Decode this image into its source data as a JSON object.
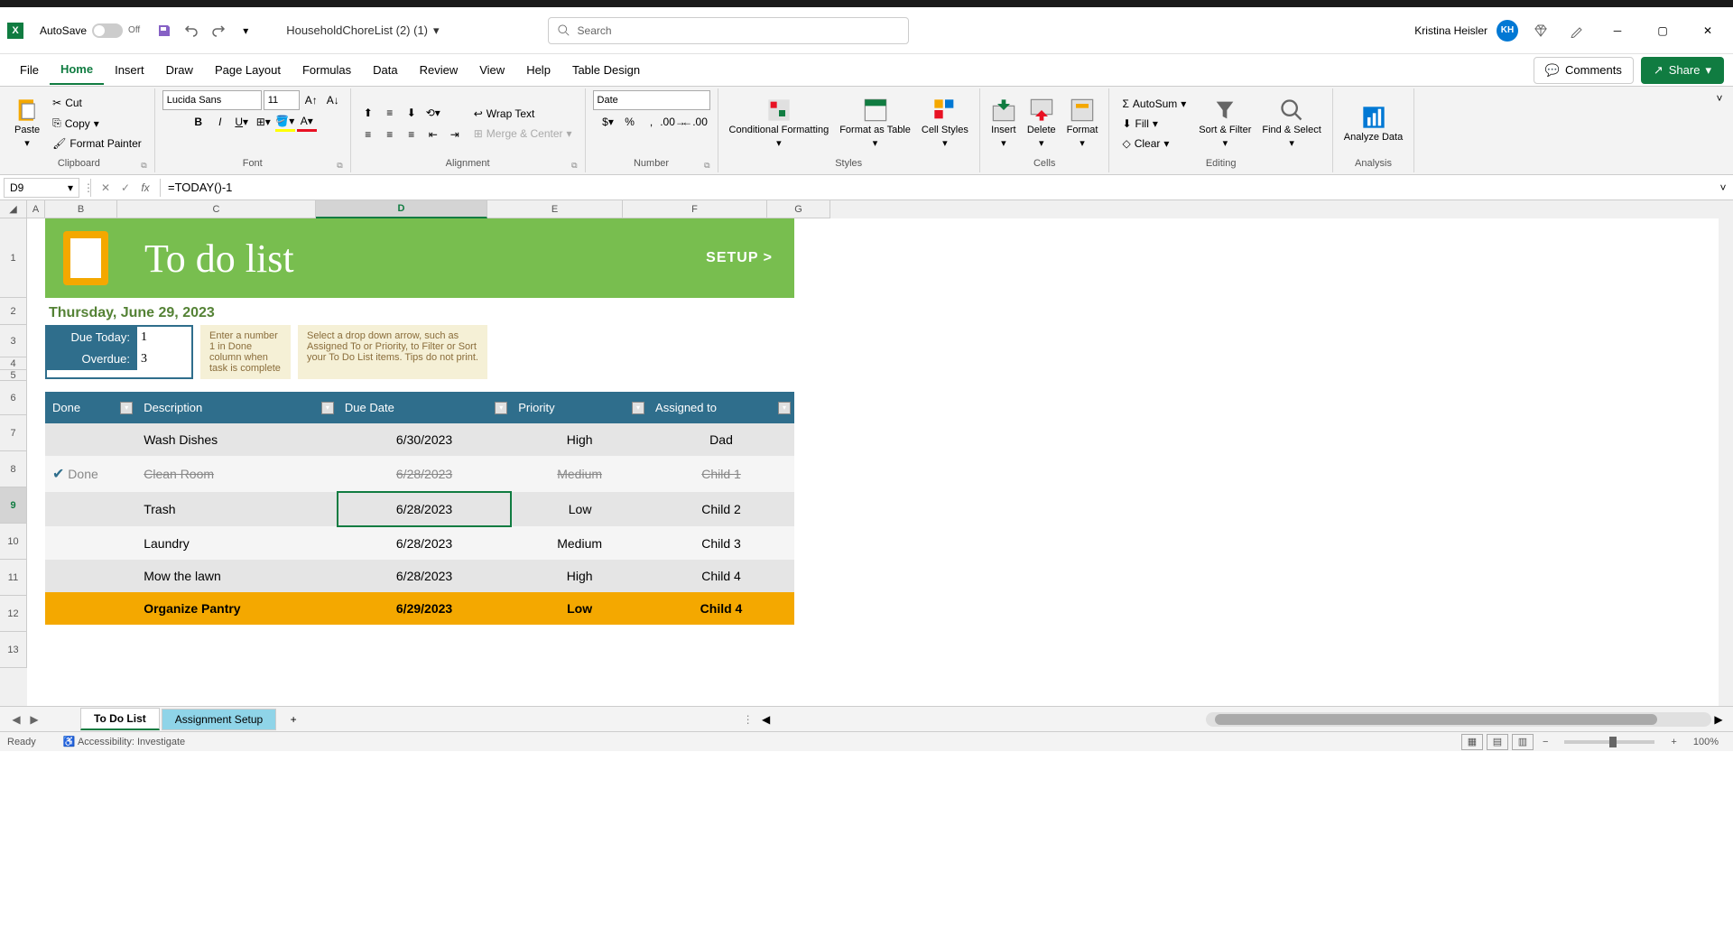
{
  "app": {
    "autosave_label": "AutoSave",
    "autosave_state": "Off",
    "filename": "HouseholdChoreList (2) (1)",
    "search_placeholder": "Search",
    "user_name": "Kristina Heisler",
    "user_initials": "KH"
  },
  "tabs": {
    "file": "File",
    "home": "Home",
    "insert": "Insert",
    "draw": "Draw",
    "page_layout": "Page Layout",
    "formulas": "Formulas",
    "data": "Data",
    "review": "Review",
    "view": "View",
    "help": "Help",
    "table_design": "Table Design",
    "comments": "Comments",
    "share": "Share"
  },
  "ribbon": {
    "clipboard": {
      "paste": "Paste",
      "cut": "Cut",
      "copy": "Copy",
      "format_painter": "Format Painter",
      "label": "Clipboard"
    },
    "font": {
      "name": "Lucida Sans",
      "size": "11",
      "label": "Font"
    },
    "alignment": {
      "wrap": "Wrap Text",
      "merge": "Merge & Center",
      "label": "Alignment"
    },
    "number": {
      "format": "Date",
      "label": "Number"
    },
    "styles": {
      "cond": "Conditional Formatting",
      "format_as": "Format as Table",
      "cell": "Cell Styles",
      "label": "Styles"
    },
    "cells": {
      "insert": "Insert",
      "delete": "Delete",
      "format": "Format",
      "label": "Cells"
    },
    "editing": {
      "autosum": "AutoSum",
      "fill": "Fill",
      "clear": "Clear",
      "sort": "Sort & Filter",
      "find": "Find & Select",
      "label": "Editing"
    },
    "analysis": {
      "analyze": "Analyze Data",
      "label": "Analysis"
    }
  },
  "formula_bar": {
    "cell_ref": "D9",
    "formula": "=TODAY()-1"
  },
  "columns": [
    "A",
    "B",
    "C",
    "D",
    "E",
    "F",
    "G"
  ],
  "rows": [
    "1",
    "2",
    "3",
    "4",
    "5",
    "6",
    "7",
    "8",
    "9",
    "10",
    "11",
    "12",
    "13"
  ],
  "todo": {
    "title": "To do list",
    "setup": "SETUP >",
    "date": "Thursday, June 29, 2023",
    "due_today_label": "Due Today:",
    "due_today_val": "1",
    "overdue_label": "Overdue:",
    "overdue_val": "3",
    "tip1": "Enter a number 1 in Done column when task is complete",
    "tip2": "Select a drop down arrow, such as Assigned To or Priority, to Filter or Sort your To Do List items. Tips do not print."
  },
  "table": {
    "headers": {
      "done": "Done",
      "desc": "Description",
      "due": "Due Date",
      "priority": "Priority",
      "assigned": "Assigned to"
    },
    "rows": [
      {
        "done": "",
        "desc": "Wash Dishes",
        "due": "6/30/2023",
        "priority": "High",
        "assigned": "Dad"
      },
      {
        "done": "Done",
        "desc": "Clean Room",
        "due": "6/28/2023",
        "priority": "Medium",
        "assigned": "Child 1"
      },
      {
        "done": "",
        "desc": "Trash",
        "due": "6/28/2023",
        "priority": "Low",
        "assigned": "Child 2"
      },
      {
        "done": "",
        "desc": "Laundry",
        "due": "6/28/2023",
        "priority": "Medium",
        "assigned": "Child 3"
      },
      {
        "done": "",
        "desc": "Mow the lawn",
        "due": "6/28/2023",
        "priority": "High",
        "assigned": "Child 4"
      },
      {
        "done": "",
        "desc": "Organize Pantry",
        "due": "6/29/2023",
        "priority": "Low",
        "assigned": "Child 4"
      }
    ]
  },
  "sheets": {
    "todo": "To Do List",
    "setup": "Assignment Setup"
  },
  "status": {
    "ready": "Ready",
    "accessibility": "Accessibility: Investigate",
    "zoom": "100%"
  }
}
